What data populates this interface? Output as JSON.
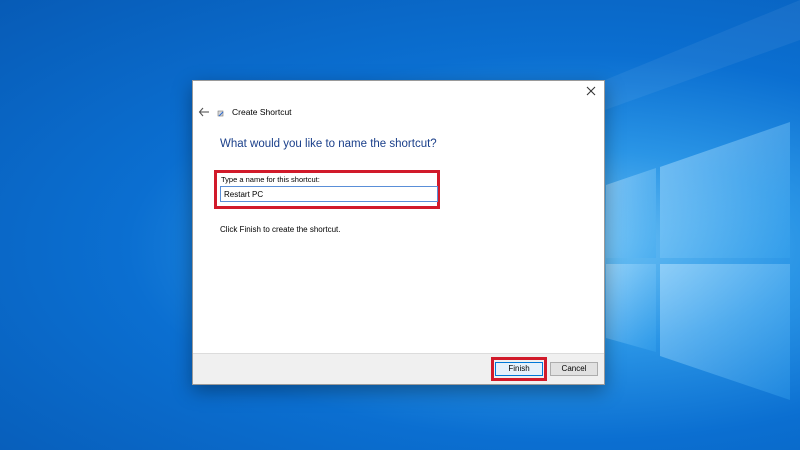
{
  "window": {
    "title": "Create Shortcut"
  },
  "page": {
    "heading": "What would you like to name the shortcut?",
    "name_label": "Type a name for this shortcut:",
    "name_value": "Restart PC",
    "info": "Click Finish to create the shortcut."
  },
  "buttons": {
    "finish": "Finish",
    "cancel": "Cancel"
  },
  "icons": {
    "close": "close-icon",
    "back": "back-arrow-icon",
    "wizard": "shortcut-wizard-icon",
    "desktop_logo": "windows-logo"
  },
  "colors": {
    "heading": "#1a3f8a",
    "highlight": "#d11a2a",
    "desktop": "#0b6fd1"
  }
}
